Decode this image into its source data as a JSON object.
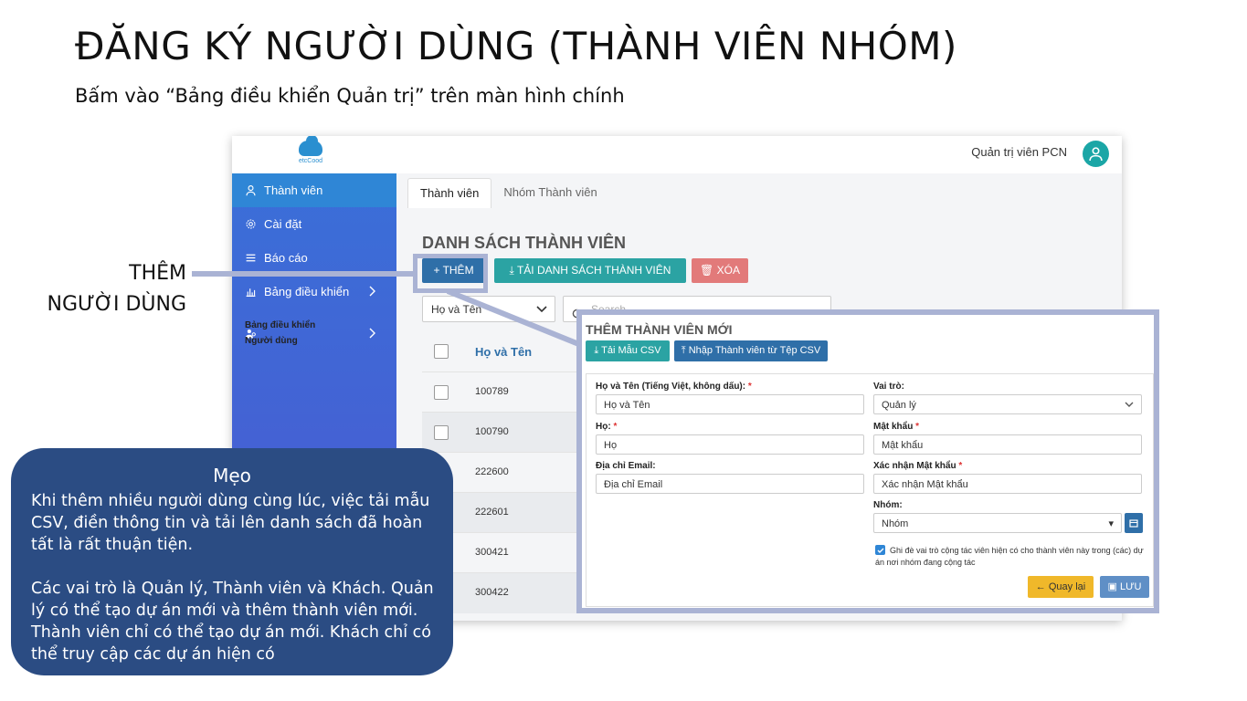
{
  "slide": {
    "title": "ĐĂNG KÝ NGƯỜI DÙNG (THÀNH VIÊN NHÓM)",
    "subtitle": "Bấm vào “Bảng điều khiển Quản trị” trên màn hình chính",
    "callout_line1": "THÊM",
    "callout_line2": "NGƯỜI DÙNG"
  },
  "topbar": {
    "logo_text": "etcCood",
    "admin_name": "Quản trị viên PCN"
  },
  "sidebar": {
    "items": [
      {
        "label": "Thành viên",
        "icon": "user-icon"
      },
      {
        "label": "Cài đặt",
        "icon": "gear-icon"
      },
      {
        "label": "Báo cáo",
        "icon": "list-icon"
      },
      {
        "label": "Bảng điều khiển",
        "icon": "bar-chart-icon"
      },
      {
        "label_line1": "Bảng điều khiển",
        "label_line2": "Người dùng",
        "icon": "users-icon"
      }
    ]
  },
  "tabs": [
    {
      "label": "Thành viên"
    },
    {
      "label": "Nhóm Thành viên"
    }
  ],
  "members": {
    "title": "DANH SÁCH THÀNH VIÊN",
    "add_label": "+ THÊM",
    "download_label": "TẢI DANH SÁCH THÀNH VIÊN",
    "delete_label": "XÓA",
    "filter_value": "Họ và Tên",
    "search_placeholder": "Search",
    "column_name": "Họ và Tên",
    "rows": [
      "100789",
      "100790",
      "222600",
      "222601",
      "300421",
      "300422"
    ]
  },
  "modal": {
    "title": "THÊM THÀNH VIÊN MỚI",
    "btn_template": "Tải Mẫu CSV",
    "btn_import": "Nhập Thành viên từ Tệp CSV",
    "fullname_label": "Họ và Tên (Tiếng Việt, không dấu):",
    "fullname_placeholder": "Họ và Tên",
    "lastname_label": "Họ:",
    "lastname_placeholder": "Họ",
    "email_label": "Địa chỉ Email:",
    "email_placeholder": "Địa chỉ Email",
    "role_label": "Vai trò:",
    "role_value": "Quản lý",
    "password_label": "Mật khẩu",
    "password_placeholder": "Mật khẩu",
    "confirm_label": "Xác nhận Mật khẩu",
    "confirm_placeholder": "Xác nhận Mật khẩu",
    "group_label": "Nhóm:",
    "group_value": "Nhóm",
    "override_text": "Ghi đè vai trò cộng tác viên hiện có cho thành viên này trong (các) dự án nơi nhóm đang cộng tác",
    "back_label": "Quay lại",
    "save_label": "LƯU",
    "required_mark": "*"
  },
  "tip": {
    "title": "Mẹo",
    "body": "Khi thêm nhiều người dùng cùng lúc, việc tải mẫu CSV, điền thông tin và tải lên danh sách đã hoàn tất là rất thuận tiện.\n\nCác vai trò là Quản lý, Thành viên và Khách. Quản lý có thể tạo dự án mới và thêm thành viên mới. Thành viên chỉ có thể tạo dự án mới. Khách chỉ có thể truy cập các dự án hiện có"
  },
  "colors": {
    "sidebar": "#4462d4",
    "sidebar_active": "#2f86d6",
    "primary": "#2f6fa8",
    "teal": "#2ba3a3",
    "danger": "#e27a7a",
    "warning": "#f0b82a",
    "annotation": "#aab3d4",
    "tip_bg": "#2b4c83"
  }
}
